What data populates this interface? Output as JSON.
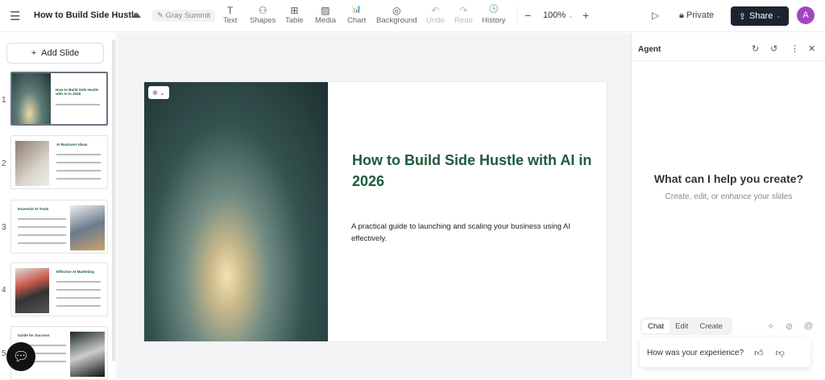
{
  "header": {
    "title": "How to Build Side Hustle",
    "theme": "Gray Summit",
    "tools": [
      {
        "label": "Text",
        "icon": "T"
      },
      {
        "label": "Shapes",
        "icon": "⚇"
      },
      {
        "label": "Table",
        "icon": "⊞"
      },
      {
        "label": "Media",
        "icon": "▨"
      },
      {
        "label": "Chart",
        "icon": "📊"
      },
      {
        "label": "Background",
        "icon": "◎"
      },
      {
        "label": "Undo",
        "icon": "↶"
      },
      {
        "label": "Redo",
        "icon": "↷"
      },
      {
        "label": "History",
        "icon": "🕓"
      }
    ],
    "zoom": "100%",
    "private": "Private",
    "share": "Share",
    "avatar": "A"
  },
  "sidebar": {
    "add_slide": "Add Slide",
    "slides": [
      {
        "num": "1",
        "title": "How to Build Side Hustle with AI in 2026"
      },
      {
        "num": "2",
        "title": "AI Business Ideas"
      },
      {
        "num": "3",
        "title": "Essential AI Tools"
      },
      {
        "num": "4",
        "title": "Effective AI Marketing"
      },
      {
        "num": "5",
        "title": "Guide for Success"
      }
    ]
  },
  "slide": {
    "title": "How to Build Side Hustle with AI in 2026",
    "subtitle": "A practical guide to launching and scaling your business using AI effectively.",
    "title_color": "#1f5a3a"
  },
  "agent": {
    "title": "Agent",
    "heading": "What can I help you create?",
    "subheading": "Create, edit, or enhance your slides",
    "tabs": [
      "Chat",
      "Edit",
      "Create"
    ],
    "feedback": "How was your experience?"
  }
}
